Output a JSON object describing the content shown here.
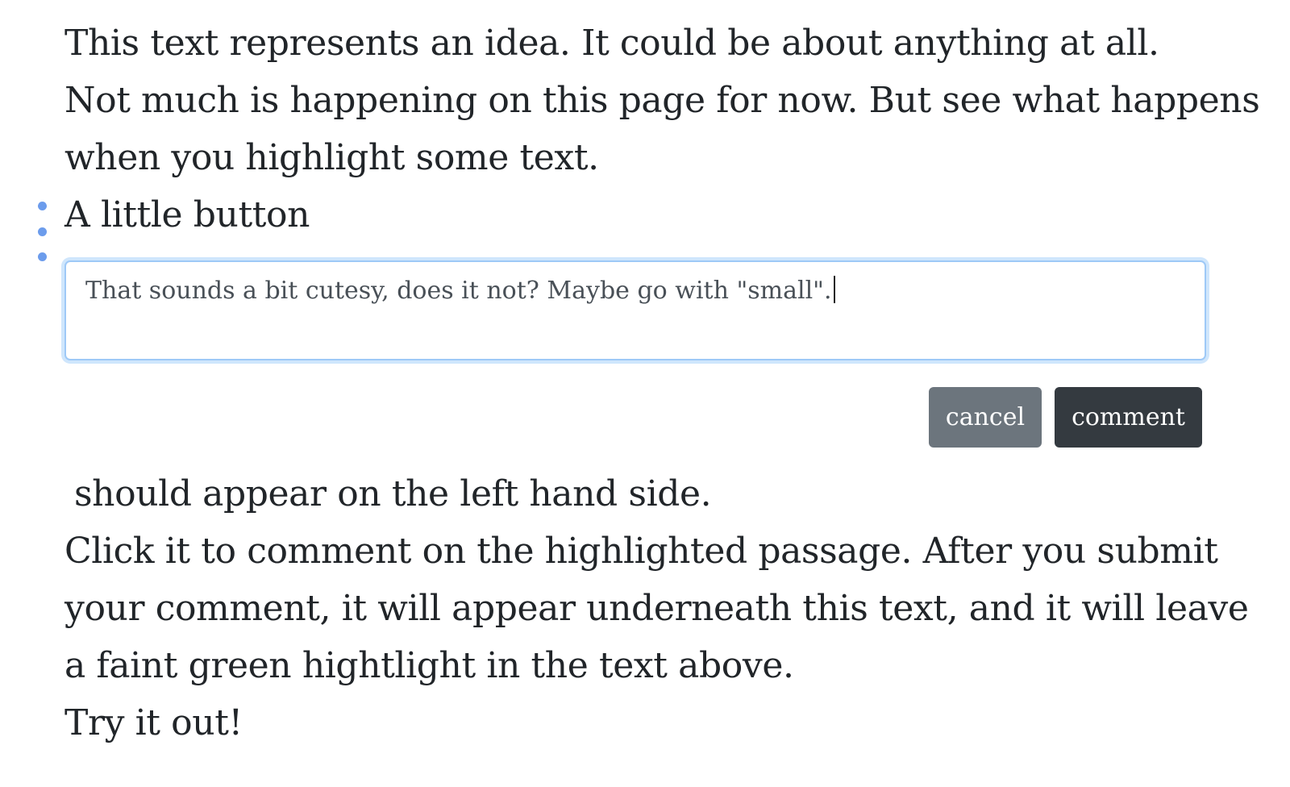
{
  "paragraphs": {
    "p1": "This text represents an idea. It could be about anything at all.",
    "p2_line1": "Not much is happening on this page for now. But see what happens",
    "p2_line2": "when you highlight some text.",
    "p3": "A little button",
    "p4": "should appear on the left hand side.",
    "p5_line1": "Click it to comment on the highlighted passage. After you submit",
    "p5_line2": "your comment, it will appear underneath this text, and it will leave",
    "p5_line3": "a faint green hightlight in the text above.",
    "p6": "Try it out!"
  },
  "comment_form": {
    "textarea_value": "That sounds a bit cutesy, does it not? Maybe go with \"small\".",
    "cancel_label": "cancel",
    "comment_label": "comment"
  },
  "icons": {
    "comment_handle": "vertical-dots-icon"
  },
  "colors": {
    "handle_dot": "#6c9cec",
    "focus_border": "#9ec9f7",
    "cancel_button": "#6c757d",
    "comment_button": "#343a40",
    "text": "#212529"
  }
}
